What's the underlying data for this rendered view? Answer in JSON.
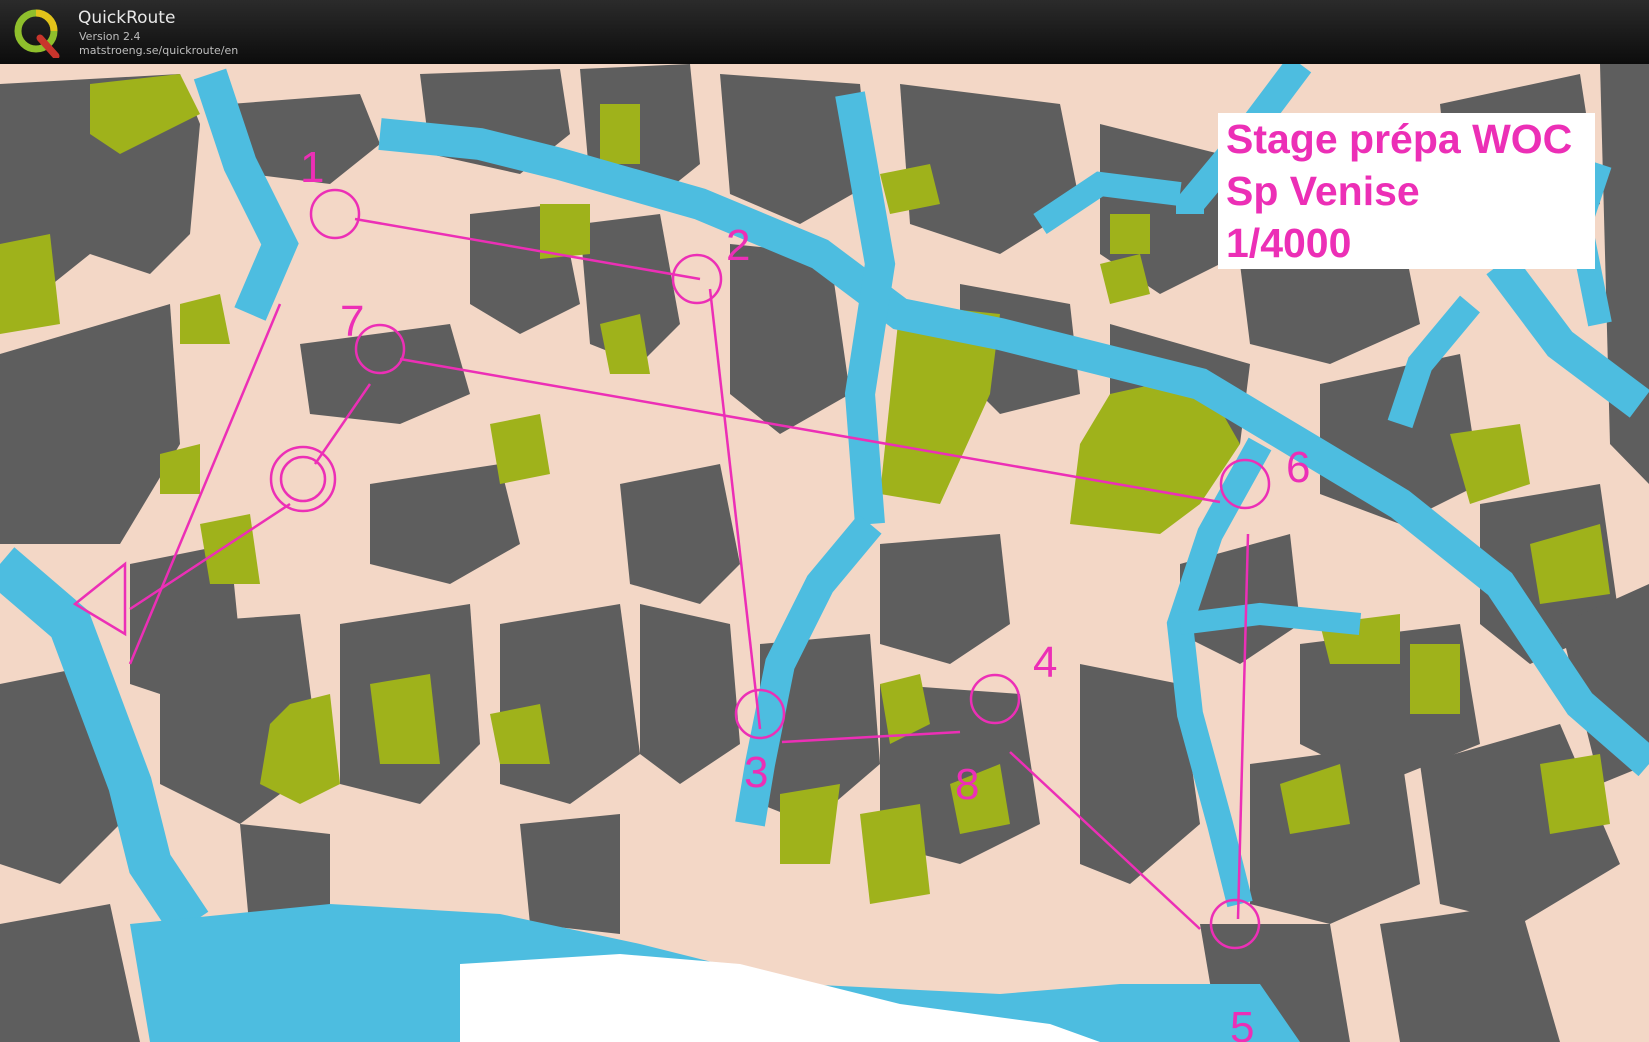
{
  "app": {
    "name": "QuickRoute",
    "version": "Version 2.4",
    "url": "matstroeng.se/quickroute/en",
    "logo_letter": "Q"
  },
  "map": {
    "legend": {
      "line1": "Stage prépa WOC",
      "line2": "Sp Venise",
      "line3": "1/4000"
    },
    "controls": [
      "1",
      "2",
      "3",
      "4",
      "5",
      "6",
      "7",
      "8"
    ],
    "colors": {
      "building": "#5e5e5e",
      "street": "#f3d7c6",
      "water": "#4dbde0",
      "vegetation": "#9fb21b",
      "course": "#ec2fb6"
    }
  }
}
